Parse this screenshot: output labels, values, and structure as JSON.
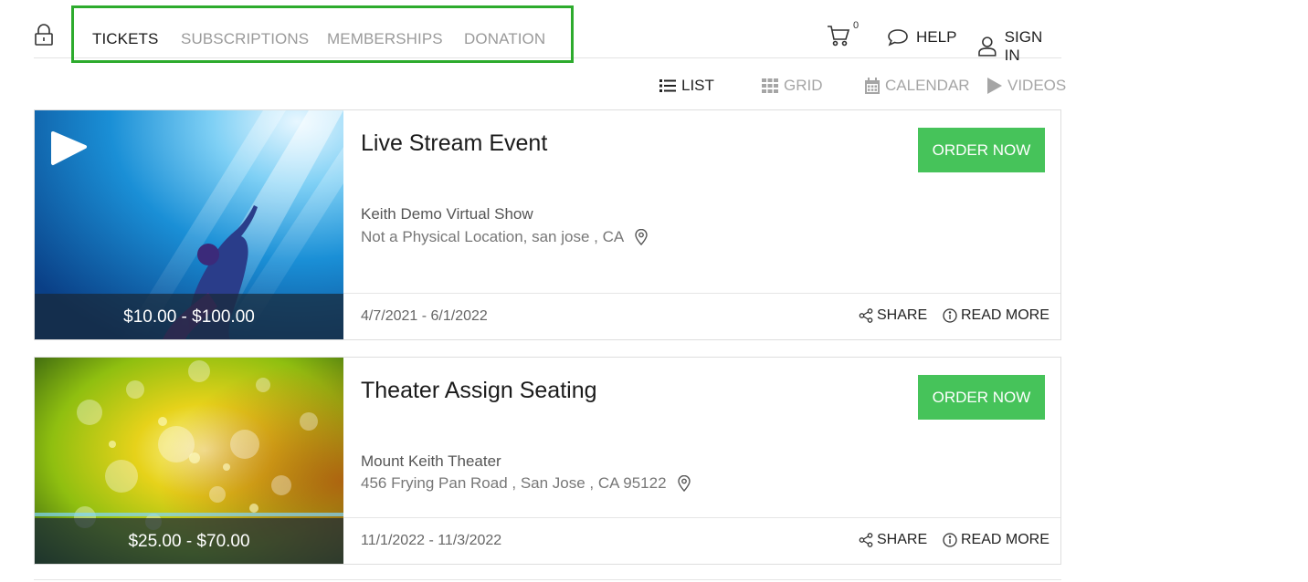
{
  "nav": {
    "tabs": [
      {
        "label": "TICKETS",
        "active": true
      },
      {
        "label": "SUBSCRIPTIONS",
        "active": false
      },
      {
        "label": "MEMBERSHIPS",
        "active": false
      },
      {
        "label": "DONATION",
        "active": false
      }
    ],
    "cart_count": "0",
    "help_label": "HELP",
    "signin_label": "SIGN IN"
  },
  "views": [
    {
      "label": "LIST",
      "icon": "list-icon",
      "active": true
    },
    {
      "label": "GRID",
      "icon": "grid-icon",
      "active": false
    },
    {
      "label": "CALENDAR",
      "icon": "calendar-icon",
      "active": false
    },
    {
      "label": "VIDEOS",
      "icon": "play-icon",
      "active": false
    }
  ],
  "events": [
    {
      "title": "Live Stream Event",
      "venue": "Keith Demo Virtual Show",
      "address": "Not a Physical Location, san jose , CA",
      "price": "$10.00 - $100.00",
      "dates": "4/7/2021 - 6/1/2022",
      "order_label": "ORDER NOW",
      "share_label": "SHARE",
      "read_more_label": "READ MORE"
    },
    {
      "title": "Theater Assign Seating",
      "venue": "Mount Keith Theater",
      "address": "456 Frying Pan Road , San Jose , CA 95122",
      "price": "$25.00 - $70.00",
      "dates": "11/1/2022 - 11/3/2022",
      "order_label": "ORDER NOW",
      "share_label": "SHARE",
      "read_more_label": "READ MORE"
    }
  ],
  "colors": {
    "accent_green": "#46c35a",
    "highlight_border": "#2dab2d"
  }
}
